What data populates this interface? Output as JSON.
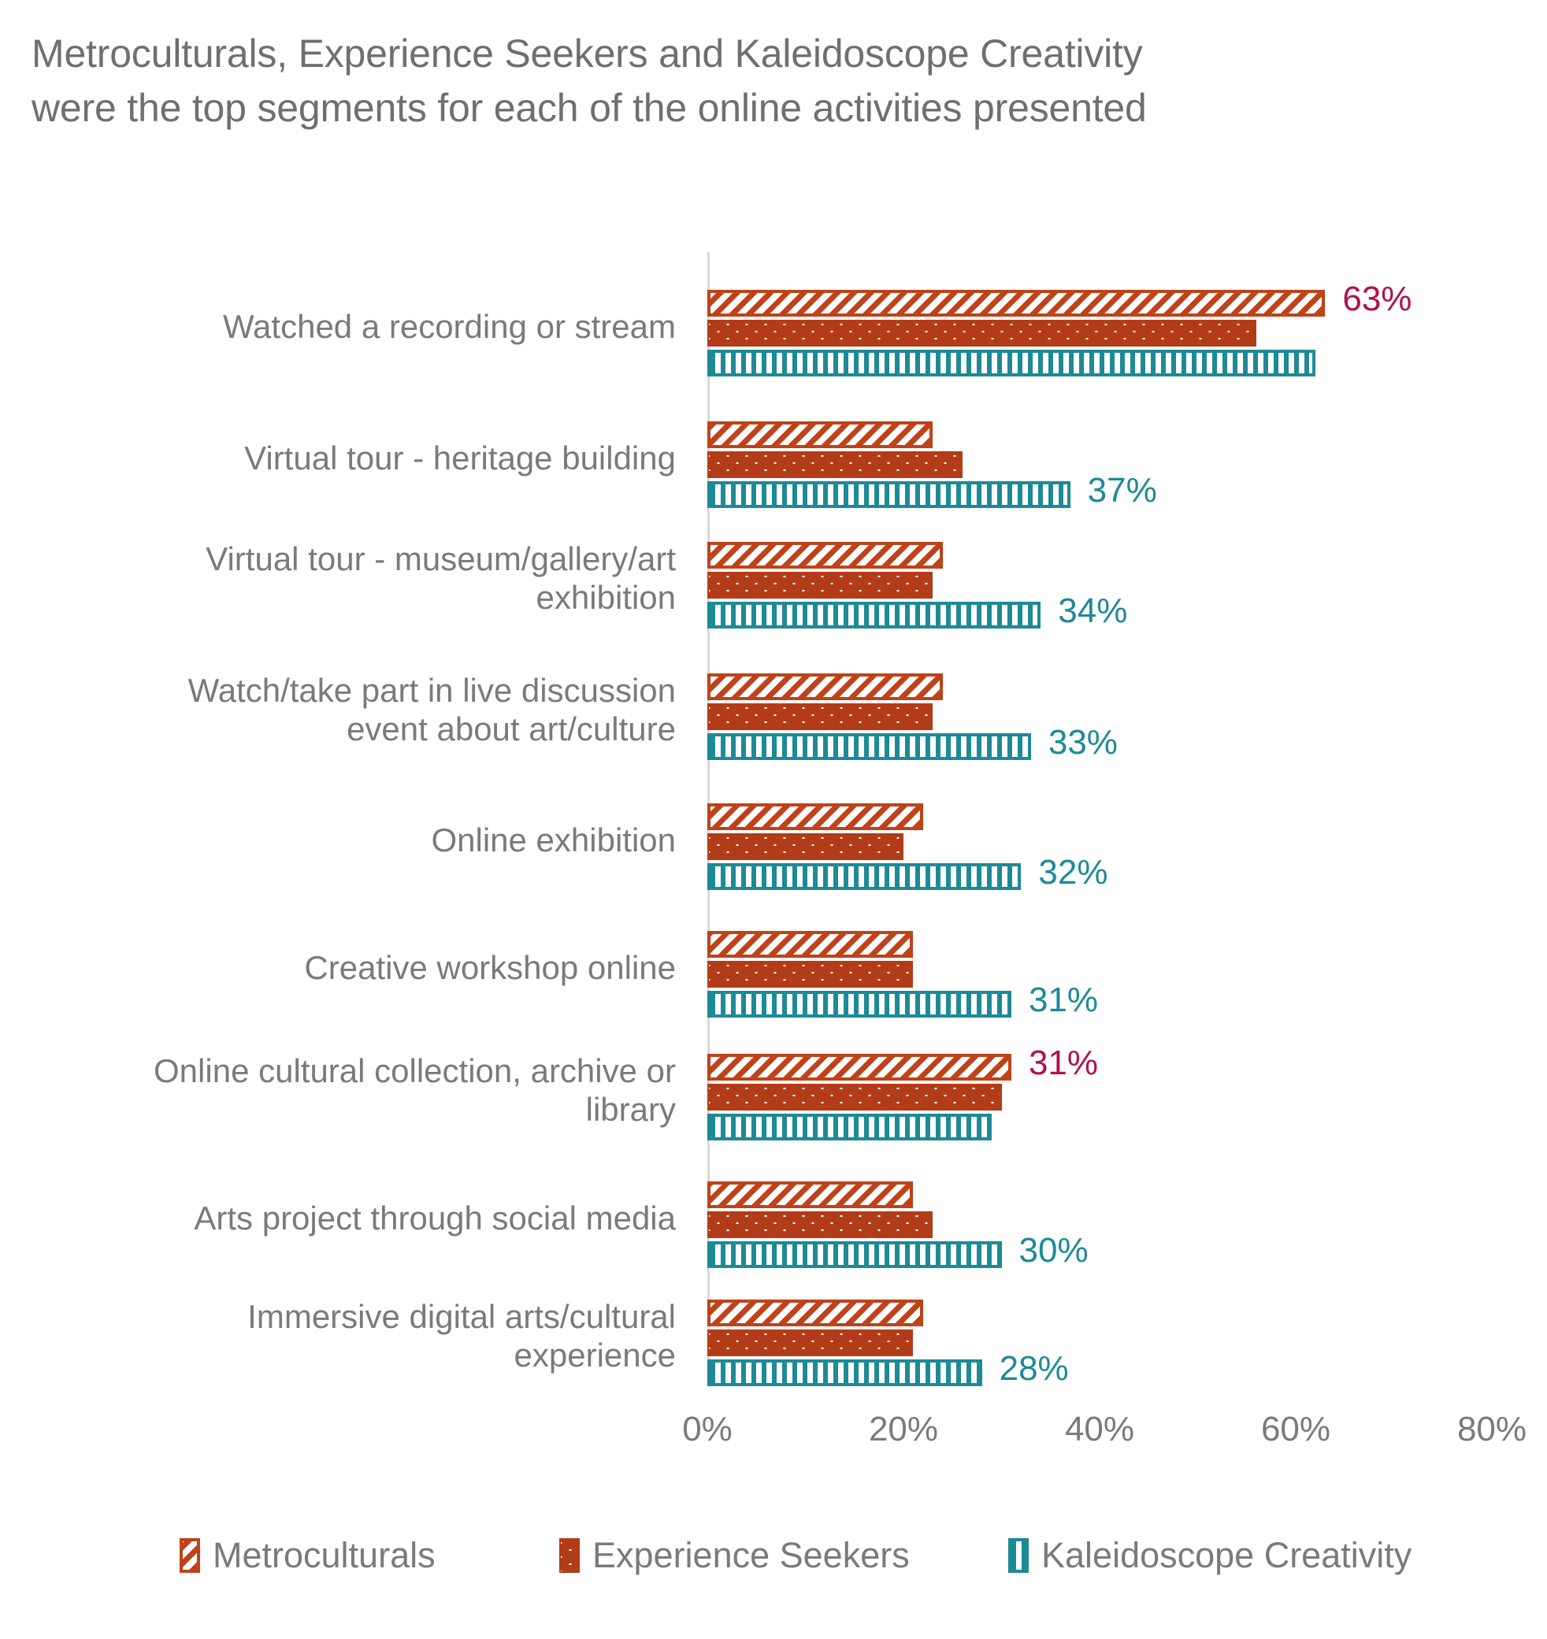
{
  "title": "Metroculturals, Experience Seekers and Kaleidoscope Creativity were the top segments for each of the online activities presented",
  "colors": {
    "metroculturals": "#bf4219",
    "experience_seekers": "#b23c18",
    "kaleidoscope": "#1d8a96",
    "label_teal": "#1d8a96",
    "label_crimson": "#b01050",
    "axis": "#d9d9d9",
    "text": "#7a7a7a"
  },
  "legend": {
    "position": "bottom",
    "items": [
      {
        "label": "Metroculturals",
        "swatch": "diagonal-hatch-swatch"
      },
      {
        "label": "Experience Seekers",
        "swatch": "dotted-swatch"
      },
      {
        "label": "Kaleidoscope Creativity",
        "swatch": "vertical-hatch-swatch"
      }
    ]
  },
  "x_axis": {
    "ticks": [
      "0%",
      "20%",
      "40%",
      "60%",
      "80%"
    ],
    "min": 0,
    "max": 80
  },
  "chart_data": {
    "type": "bar",
    "orientation": "horizontal",
    "title": "Metroculturals, Experience Seekers and Kaleidoscope Creativity were the top segments for each of the online activities presented",
    "xlabel": "",
    "ylabel": "",
    "xlim": [
      0,
      80
    ],
    "grid": false,
    "legend_position": "bottom",
    "categories": [
      "Watched a recording or stream",
      "Virtual tour - heritage building",
      "Virtual tour - museum/gallery/art exhibition",
      "Watch/take part in live discussion event about art/culture",
      "Online exhibition",
      "Creative workshop online",
      "Online cultural collection, archive or library",
      "Arts project through social media",
      "Immersive digital arts/cultural experience"
    ],
    "series": [
      {
        "name": "Metroculturals",
        "values": [
          63,
          23,
          24,
          24,
          22,
          21,
          31,
          21,
          22
        ]
      },
      {
        "name": "Experience Seekers",
        "values": [
          56,
          26,
          23,
          23,
          20,
          21,
          30,
          23,
          21
        ]
      },
      {
        "name": "Kaleidoscope Creativity",
        "values": [
          62,
          37,
          34,
          33,
          32,
          31,
          29,
          30,
          28
        ]
      }
    ],
    "data_labels": [
      {
        "category_index": 0,
        "series": "Metroculturals",
        "text": "63%",
        "color": "#b01050"
      },
      {
        "category_index": 1,
        "series": "Kaleidoscope Creativity",
        "text": "37%",
        "color": "#1d8a96"
      },
      {
        "category_index": 2,
        "series": "Kaleidoscope Creativity",
        "text": "34%",
        "color": "#1d8a96"
      },
      {
        "category_index": 3,
        "series": "Kaleidoscope Creativity",
        "text": "33%",
        "color": "#1d8a96"
      },
      {
        "category_index": 4,
        "series": "Kaleidoscope Creativity",
        "text": "32%",
        "color": "#1d8a96"
      },
      {
        "category_index": 5,
        "series": "Kaleidoscope Creativity",
        "text": "31%",
        "color": "#1d8a96"
      },
      {
        "category_index": 6,
        "series": "Metroculturals",
        "text": "31%",
        "color": "#b01050"
      },
      {
        "category_index": 7,
        "series": "Kaleidoscope Creativity",
        "text": "30%",
        "color": "#1d8a96"
      },
      {
        "category_index": 8,
        "series": "Kaleidoscope Creativity",
        "text": "28%",
        "color": "#1d8a96"
      }
    ]
  },
  "category_label_lines": [
    [
      "Watched a recording or stream"
    ],
    [
      "Virtual tour - heritage building"
    ],
    [
      "Virtual tour - museum/gallery/art",
      "exhibition"
    ],
    [
      "Watch/take part in live discussion",
      "event about art/culture"
    ],
    [
      "Online exhibition"
    ],
    [
      "Creative workshop online"
    ],
    [
      "Online cultural collection, archive or",
      "library"
    ],
    [
      "Arts project through social media"
    ],
    [
      "Immersive digital arts/cultural",
      "experience"
    ]
  ]
}
